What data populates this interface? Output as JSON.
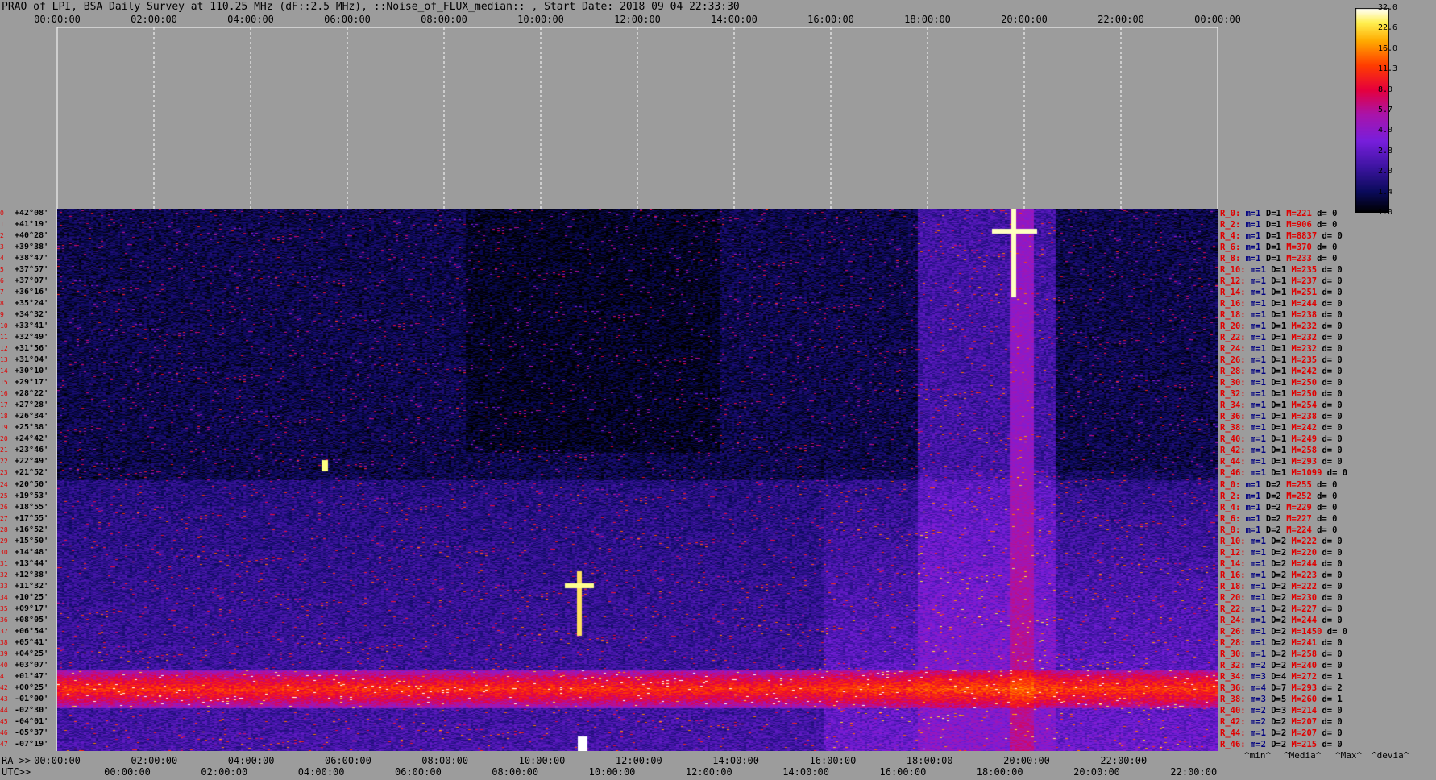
{
  "title": "PRAO of LPI, BSA Daily Survey at 110.25 MHz (dF::2.5 MHz), ::Noise_of_FLUX_median:: , Start Date: 2018 09 04 22:33:30",
  "top_ticks": [
    "00:00:00",
    "02:00:00",
    "04:00:00",
    "06:00:00",
    "08:00:00",
    "10:00:00",
    "12:00:00",
    "14:00:00",
    "16:00:00",
    "18:00:00",
    "20:00:00",
    "22:00:00",
    "00:00:00"
  ],
  "bottom": {
    "ra_label": "RA >>",
    "utc_label": "UTC>>",
    "ra_ticks": [
      "00:00:00",
      "02:00:00",
      "04:00:00",
      "06:00:00",
      "08:00:00",
      "10:00:00",
      "12:00:00",
      "14:00:00",
      "16:00:00",
      "18:00:00",
      "20:00:00",
      "22:00:00"
    ],
    "utc_ticks": [
      "00:00:00",
      "02:00:00",
      "04:00:00",
      "06:00:00",
      "08:00:00",
      "10:00:00",
      "12:00:00",
      "14:00:00",
      "16:00:00",
      "18:00:00",
      "20:00:00",
      "22:00:00"
    ]
  },
  "legend": {
    "min": "^min^",
    "median": "^Media^",
    "max": "^Max^",
    "devia": "^devia^"
  },
  "colors": {
    "min": "#000080",
    "median": "#000000",
    "max": "#e00000",
    "devia": "#000000",
    "rowlabel": "#e00000"
  },
  "chart_data": {
    "type": "heatmap",
    "x_axis": "RA / UTC",
    "colorbar": {
      "ticks": [
        "32.0",
        "22.6",
        "16.0",
        "11.3",
        "8.0",
        "5.7",
        "4.0",
        "2.8",
        "2.0",
        "1.4",
        "1.0"
      ],
      "range": [
        1.0,
        32.0
      ],
      "scale": "log"
    },
    "declinations": [
      "+42°08'",
      "+41°19'",
      "+40°28'",
      "+39°38'",
      "+38°47'",
      "+37°57'",
      "+37°07'",
      "+36°16'",
      "+35°24'",
      "+34°32'",
      "+33°41'",
      "+32°49'",
      "+31°56'",
      "+31°04'",
      "+30°10'",
      "+29°17'",
      "+28°22'",
      "+27°28'",
      "+26°34'",
      "+25°38'",
      "+24°42'",
      "+23°46'",
      "+22°49'",
      "+21°52'",
      "+20°50'",
      "+19°53'",
      "+18°55'",
      "+17°55'",
      "+16°52'",
      "+15°50'",
      "+14°48'",
      "+13°44'",
      "+12°38'",
      "+11°32'",
      "+10°25'",
      "+09°17'",
      "+08°05'",
      "+06°54'",
      "+05°41'",
      "+04°25'",
      "+03°07'",
      "+01°47'",
      "+00°25'",
      "-01°00'",
      "-02°30'",
      "-04°01'",
      "-05°37'",
      "-07°19'"
    ],
    "row_stats": [
      {
        "r": "R_0:",
        "m": "1",
        "D": "1",
        "M": "221",
        "d": "0"
      },
      {
        "r": "R_2:",
        "m": "1",
        "D": "1",
        "M": "906",
        "d": "0"
      },
      {
        "r": "R_4:",
        "m": "1",
        "D": "1",
        "M": "8837",
        "d": "0"
      },
      {
        "r": "R_6:",
        "m": "1",
        "D": "1",
        "M": "370",
        "d": "0"
      },
      {
        "r": "R_8:",
        "m": "1",
        "D": "1",
        "M": "233",
        "d": "0"
      },
      {
        "r": "R_10:",
        "m": "1",
        "D": "1",
        "M": "235",
        "d": "0"
      },
      {
        "r": "R_12:",
        "m": "1",
        "D": "1",
        "M": "237",
        "d": "0"
      },
      {
        "r": "R_14:",
        "m": "1",
        "D": "1",
        "M": "251",
        "d": "0"
      },
      {
        "r": "R_16:",
        "m": "1",
        "D": "1",
        "M": "244",
        "d": "0"
      },
      {
        "r": "R_18:",
        "m": "1",
        "D": "1",
        "M": "238",
        "d": "0"
      },
      {
        "r": "R_20:",
        "m": "1",
        "D": "1",
        "M": "232",
        "d": "0"
      },
      {
        "r": "R_22:",
        "m": "1",
        "D": "1",
        "M": "232",
        "d": "0"
      },
      {
        "r": "R_24:",
        "m": "1",
        "D": "1",
        "M": "232",
        "d": "0"
      },
      {
        "r": "R_26:",
        "m": "1",
        "D": "1",
        "M": "235",
        "d": "0"
      },
      {
        "r": "R_28:",
        "m": "1",
        "D": "1",
        "M": "242",
        "d": "0"
      },
      {
        "r": "R_30:",
        "m": "1",
        "D": "1",
        "M": "250",
        "d": "0"
      },
      {
        "r": "R_32:",
        "m": "1",
        "D": "1",
        "M": "250",
        "d": "0"
      },
      {
        "r": "R_34:",
        "m": "1",
        "D": "1",
        "M": "254",
        "d": "0"
      },
      {
        "r": "R_36:",
        "m": "1",
        "D": "1",
        "M": "238",
        "d": "0"
      },
      {
        "r": "R_38:",
        "m": "1",
        "D": "1",
        "M": "242",
        "d": "0"
      },
      {
        "r": "R_40:",
        "m": "1",
        "D": "1",
        "M": "249",
        "d": "0"
      },
      {
        "r": "R_42:",
        "m": "1",
        "D": "1",
        "M": "258",
        "d": "0"
      },
      {
        "r": "R_44:",
        "m": "1",
        "D": "1",
        "M": "293",
        "d": "0"
      },
      {
        "r": "R_46:",
        "m": "1",
        "D": "1",
        "M": "1099",
        "d": "0"
      },
      {
        "r": "R_0:",
        "m": "1",
        "D": "2",
        "M": "255",
        "d": "0"
      },
      {
        "r": "R_2:",
        "m": "1",
        "D": "2",
        "M": "252",
        "d": "0"
      },
      {
        "r": "R_4:",
        "m": "1",
        "D": "2",
        "M": "229",
        "d": "0"
      },
      {
        "r": "R_6:",
        "m": "1",
        "D": "2",
        "M": "227",
        "d": "0"
      },
      {
        "r": "R_8:",
        "m": "1",
        "D": "2",
        "M": "224",
        "d": "0"
      },
      {
        "r": "R_10:",
        "m": "1",
        "D": "2",
        "M": "222",
        "d": "0"
      },
      {
        "r": "R_12:",
        "m": "1",
        "D": "2",
        "M": "220",
        "d": "0"
      },
      {
        "r": "R_14:",
        "m": "1",
        "D": "2",
        "M": "244",
        "d": "0"
      },
      {
        "r": "R_16:",
        "m": "1",
        "D": "2",
        "M": "223",
        "d": "0"
      },
      {
        "r": "R_18:",
        "m": "1",
        "D": "2",
        "M": "222",
        "d": "0"
      },
      {
        "r": "R_20:",
        "m": "1",
        "D": "2",
        "M": "230",
        "d": "0"
      },
      {
        "r": "R_22:",
        "m": "1",
        "D": "2",
        "M": "227",
        "d": "0"
      },
      {
        "r": "R_24:",
        "m": "1",
        "D": "2",
        "M": "244",
        "d": "0"
      },
      {
        "r": "R_26:",
        "m": "1",
        "D": "2",
        "M": "1450",
        "d": "0"
      },
      {
        "r": "R_28:",
        "m": "1",
        "D": "2",
        "M": "241",
        "d": "0"
      },
      {
        "r": "R_30:",
        "m": "1",
        "D": "2",
        "M": "258",
        "d": "0"
      },
      {
        "r": "R_32:",
        "m": "2",
        "D": "2",
        "M": "240",
        "d": "0"
      },
      {
        "r": "R_34:",
        "m": "3",
        "D": "4",
        "M": "272",
        "d": "1"
      },
      {
        "r": "R_36:",
        "m": "4",
        "D": "7",
        "M": "293",
        "d": "2"
      },
      {
        "r": "R_38:",
        "m": "3",
        "D": "5",
        "M": "260",
        "d": "1"
      },
      {
        "r": "R_40:",
        "m": "2",
        "D": "3",
        "M": "214",
        "d": "0"
      },
      {
        "r": "R_42:",
        "m": "2",
        "D": "2",
        "M": "207",
        "d": "0"
      },
      {
        "r": "R_44:",
        "m": "1",
        "D": "2",
        "M": "207",
        "d": "0"
      },
      {
        "r": "R_46:",
        "m": "2",
        "D": "2",
        "M": "215",
        "d": "0"
      }
    ]
  }
}
